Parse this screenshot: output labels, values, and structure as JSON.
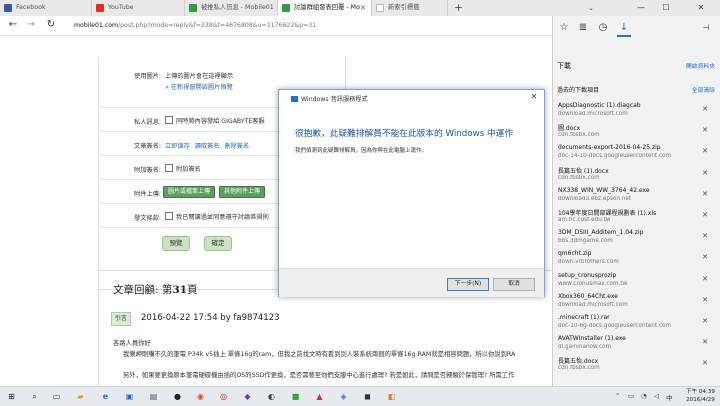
{
  "tabs": [
    {
      "title": "Facebook",
      "color": "#3b5998"
    },
    {
      "title": "YouTube",
      "color": "#e52d27"
    },
    {
      "title": "被推私人訊息 - Mobile01",
      "color": "#2e9c3f"
    },
    {
      "title": "討論群組發表回覆 - Mo",
      "color": "#2e9c3f"
    },
    {
      "title": "新索引標籤",
      "color": "#bbbbbb"
    }
  ],
  "active_tab": 3,
  "address": {
    "host": "mobile01.com",
    "path": "/post.php?mode=reply&f=238&t=4676808&u=1176622&p=31"
  },
  "form": {
    "image_label": "使用圖片:",
    "image_value": "上傳的圖片會在這裡顯示",
    "image_link": "» 在新視窗開啟圖片預覽",
    "private_label": "私人訊息:",
    "private_value": "同時將內容發給 GIGABYTE客服",
    "sig_label": "文章簽名:",
    "sig_actions": [
      "立即儲存",
      "讀取簽名",
      "刪除簽名"
    ],
    "addsig_label": "附加簽名:",
    "addsig_value": "附加簽名",
    "upload_label": "附件上傳:",
    "upload_buttons": [
      "圖片或檔案上傳",
      "其他附件上傳"
    ],
    "agree_label": "發文條款:",
    "agree_value": "我已閱讀過並同意遵守討論區規則",
    "preview_button": "預覽",
    "submit_button": "確定"
  },
  "replies": {
    "title_prefix": "文章回顧: 第",
    "page_number": "31",
    "title_suffix": "頁",
    "quote_button": "引言",
    "meta": "2016-04-22 17:54 by fa9874123",
    "lines": [
      "各路人員你好",
      "我樂岬剛購不久的筆電 P34k v5插上 單條16g的ram，但我之前找文時有看到別人裝系統兩個的單條16g RAM就是相容問題，所以你說到RA",
      "另外，如果要更換原本筆電硬碟機由插的OS的SSD作更換，是否需要至你們支服中心進行處理? 若是如此，請問是否歸類於保管理? 所需工作"
    ]
  },
  "dialog": {
    "title": "Windows 音訊服務程式",
    "heading": "很抱歉，此疑難排解員不能在此版本的 Windows 中運作",
    "body": "我們偵測到此疑難排解員，因為你與在此電腦上運作。",
    "next_button": "下一步(N)",
    "cancel_button": "取消"
  },
  "hub": {
    "title": "下載",
    "open_folder": "開啟資料夾",
    "past_label": "過去的下載項目",
    "clear_all": "全部清除",
    "items": [
      {
        "name": "AppsDiagnostic (1).diagcab",
        "src": "download.microsoft.com"
      },
      {
        "name": "圖.docx",
        "src": "cdn.fbsbx.com"
      },
      {
        "name": "documents-export-2016-04-25.zip",
        "src": "doc-14-10-docs.googleusercontent.com"
      },
      {
        "name": "長篇五怡 (1).docx",
        "src": "cdn.fbsbx.com"
      },
      {
        "name": "NX338_WIN_WW_3764_42.exe",
        "src": "download3.ebz.epson.net"
      },
      {
        "name": "104學年度日間部課程規劃表 (1).xls",
        "src": "am.hc.cust.edu.tw"
      },
      {
        "name": "3DM_DSIII_Additem_1.04.zip",
        "src": "bbs.3dmgame.com"
      },
      {
        "name": "qm6cht.zip",
        "src": "down.vrbrothers.com"
      },
      {
        "name": "setup_cronusprozip",
        "src": "www.cronusmax.com.tw"
      },
      {
        "name": "Xbox360_64Cht.exe",
        "src": "download.microsoft.com"
      },
      {
        "name": ".minecraft (1).rar",
        "src": "doc-10-6g-docs.googleusercontent.com"
      },
      {
        "name": "AVATWInstaller (1).exe",
        "src": "dl.gaininanow.com"
      },
      {
        "name": "長篇五怡.docx",
        "src": "cdn.fbsbx.com"
      }
    ]
  },
  "taskbar": {
    "time": "下午 04:39",
    "date": "2016/4/29"
  }
}
